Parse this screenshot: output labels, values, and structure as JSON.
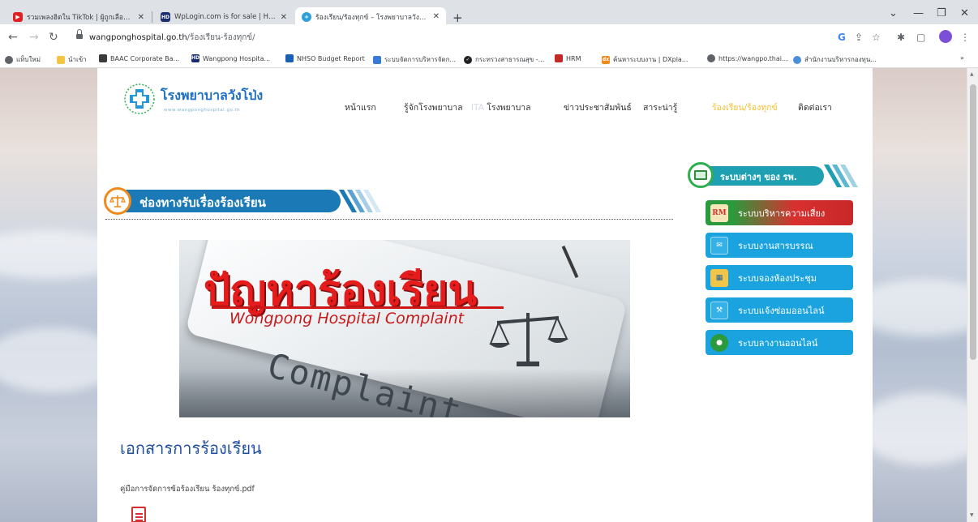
{
  "browser": {
    "tabs": [
      {
        "label": "รวมเพลงฮิตใน TikTok | ผู้ถูกเลือกให้ผิ...",
        "icon": "youtube-icon",
        "active": false
      },
      {
        "label": "WpLogin.com is for sale | HugeD...",
        "icon": "hd-icon",
        "active": false
      },
      {
        "label": "ร้องเรียน/ร้องทุกข์ – โรงพยาบาลวังโป่ง",
        "icon": "hospital-icon",
        "active": true
      }
    ],
    "new_tab": "+",
    "url_host": "wangponghospital.go.th",
    "url_path": "/ร้องเรียน-ร้องทุกข์/",
    "bookmarks": [
      {
        "label": "แท็บใหม่",
        "icon": "globe-icon"
      },
      {
        "label": "นำเข้า",
        "icon": "folder-icon"
      },
      {
        "label": "BAAC Corporate Ba...",
        "icon": "baac-icon"
      },
      {
        "label": "Wangpong Hospita...",
        "icon": "hd-icon"
      },
      {
        "label": "NHSO Budget Report",
        "icon": "nhso-icon"
      },
      {
        "label": "ระบบจัดการบริหารจัดก...",
        "icon": "system-icon"
      },
      {
        "label": "กระทรวงสาธารณสุข -...",
        "icon": "check-icon"
      },
      {
        "label": "HRM",
        "icon": "hrm-icon"
      },
      {
        "label": "ค้นหาระบบงาน | DXpla...",
        "icon": "dx-icon"
      },
      {
        "label": "https://wangpo.thai...",
        "icon": "globe-icon"
      },
      {
        "label": "สำนักงานบริหารกองทุน...",
        "icon": "fund-icon"
      }
    ],
    "bookmarks_more": "»"
  },
  "site": {
    "brand": "โรงพยาบาลวังโป่ง",
    "brand_url": "www.wangponghospital.go.th",
    "menu": [
      {
        "label": "หน้าแรก",
        "active": false
      },
      {
        "label": "รู้จักโรงพยาบาล",
        "active": false
      },
      {
        "label": "โรงพยาบาล",
        "prefix": "ITA",
        "active": false
      },
      {
        "label": "ข่าวประชาสัมพันธ์",
        "active": false
      },
      {
        "label": "สาระน่ารู้",
        "active": false
      },
      {
        "label": "ร้องเรียน/ร้องทุกข์",
        "active": true
      },
      {
        "label": "ติดต่อเรา",
        "active": false
      }
    ]
  },
  "systems": {
    "title": "ระบบต่างๆ ของ รพ.",
    "items": [
      {
        "label": "ระบบบริหารความเสี่ยง",
        "badge": "RM",
        "color": "#d8302f",
        "color2": "#2a9a3c"
      },
      {
        "label": "ระบบงานสารบรรณ",
        "badge": "",
        "color": "#1aa3de",
        "color2": "#1aa3de"
      },
      {
        "label": "ระบบจองห้องประชุม",
        "badge": "",
        "color": "#1aa3de",
        "color2": "#1aa3de"
      },
      {
        "label": "ระบบแจ้งซ่อมออนไลน์",
        "badge": "",
        "color": "#1aa3de",
        "color2": "#1aa3de"
      },
      {
        "label": "ระบบลางานออนไลน์",
        "badge": "",
        "color": "#1aa3de",
        "color2": "#1aa3de"
      }
    ]
  },
  "channel": {
    "title": "ช่องทางรับเรื่องร้องเรียน"
  },
  "banner": {
    "main": "ปัญหาร้องเรียน",
    "sub": "Wongpong Hospital Complaint",
    "word": "Complaint"
  },
  "documents": {
    "title": "เอกสารการร้องเรียน",
    "file": "คู่มือการจัดการข้อร้องเรียน ร้องทุกข์.pdf"
  }
}
